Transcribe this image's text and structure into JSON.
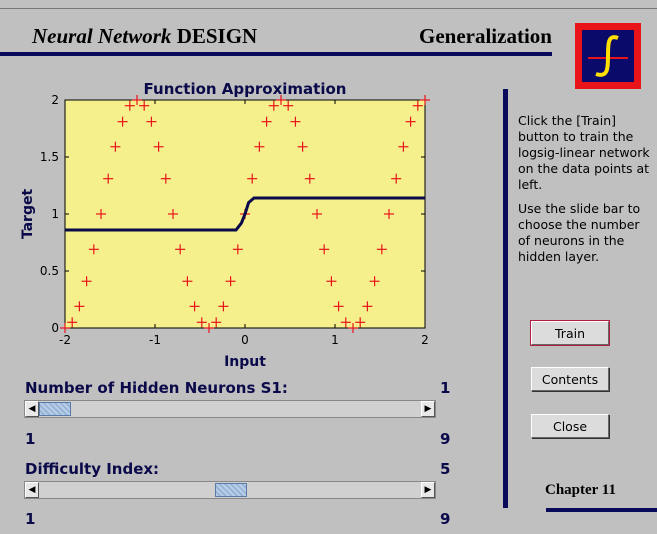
{
  "header": {
    "brand_italic": "Neural Network",
    "brand_bold": "DESIGN",
    "page_title": "Generalization"
  },
  "chart_data": {
    "type": "scatter",
    "title": "Function Approximation",
    "xlabel": "Input",
    "ylabel": "Target",
    "xlim": [
      -2,
      2
    ],
    "ylim": [
      0,
      2
    ],
    "xticks": [
      "-2",
      "-1",
      "0",
      "1",
      "2"
    ],
    "yticks": [
      "0",
      "0.5",
      "1",
      "1.5",
      "2"
    ],
    "series": [
      {
        "marker": "plus",
        "color": "#e8141a",
        "x": [
          -2.0,
          -1.92,
          -1.84,
          -1.76,
          -1.68,
          -1.6,
          -1.52,
          -1.44,
          -1.36,
          -1.28,
          -1.2,
          -1.12,
          -1.04,
          -0.96,
          -0.88,
          -0.8,
          -0.72,
          -0.64,
          -0.56,
          -0.48,
          -0.4,
          -0.32,
          -0.24,
          -0.16,
          -0.08,
          0.0,
          0.08,
          0.16,
          0.24,
          0.32,
          0.4,
          0.48,
          0.56,
          0.64,
          0.72,
          0.8,
          0.88,
          0.96,
          1.04,
          1.12,
          1.2,
          1.28,
          1.36,
          1.44,
          1.52,
          1.6,
          1.68,
          1.76,
          1.84,
          1.92,
          2.0
        ],
        "y": [
          0.0,
          0.05,
          0.19,
          0.41,
          0.69,
          1.0,
          1.31,
          1.59,
          1.81,
          1.95,
          2.0,
          1.95,
          1.81,
          1.59,
          1.31,
          1.0,
          0.69,
          0.41,
          0.19,
          0.05,
          0.0,
          0.05,
          0.19,
          0.41,
          0.69,
          1.0,
          1.31,
          1.59,
          1.81,
          1.95,
          2.0,
          1.95,
          1.81,
          1.59,
          1.31,
          1.0,
          0.69,
          0.41,
          0.19,
          0.05,
          0.0,
          0.05,
          0.19,
          0.41,
          0.69,
          1.0,
          1.31,
          1.59,
          1.81,
          1.95,
          2.0
        ]
      },
      {
        "marker": "line",
        "color": "#0a0a4a",
        "x": [
          -2.0,
          -0.1,
          -0.04,
          0.0,
          0.04,
          0.1,
          2.0
        ],
        "y": [
          0.86,
          0.86,
          0.92,
          1.0,
          1.1,
          1.14,
          1.14
        ]
      }
    ],
    "background": "#f5f08c"
  },
  "description": {
    "p1": "Click the [Train] button to train the logsig-linear network on the data points at left.",
    "p2": "Use the slide bar to choose the number of neurons in the hidden layer."
  },
  "buttons": {
    "train": "Train",
    "contents": "Contents",
    "close": "Close"
  },
  "neurons": {
    "label": "Number of Hidden Neurons S1:",
    "value": "1",
    "min": "1",
    "max": "9",
    "position": 1
  },
  "difficulty": {
    "label": "Difficulty Index:",
    "value": "5",
    "min": "1",
    "max": "9",
    "position": 5
  },
  "footer": {
    "chapter": "Chapter 11"
  }
}
